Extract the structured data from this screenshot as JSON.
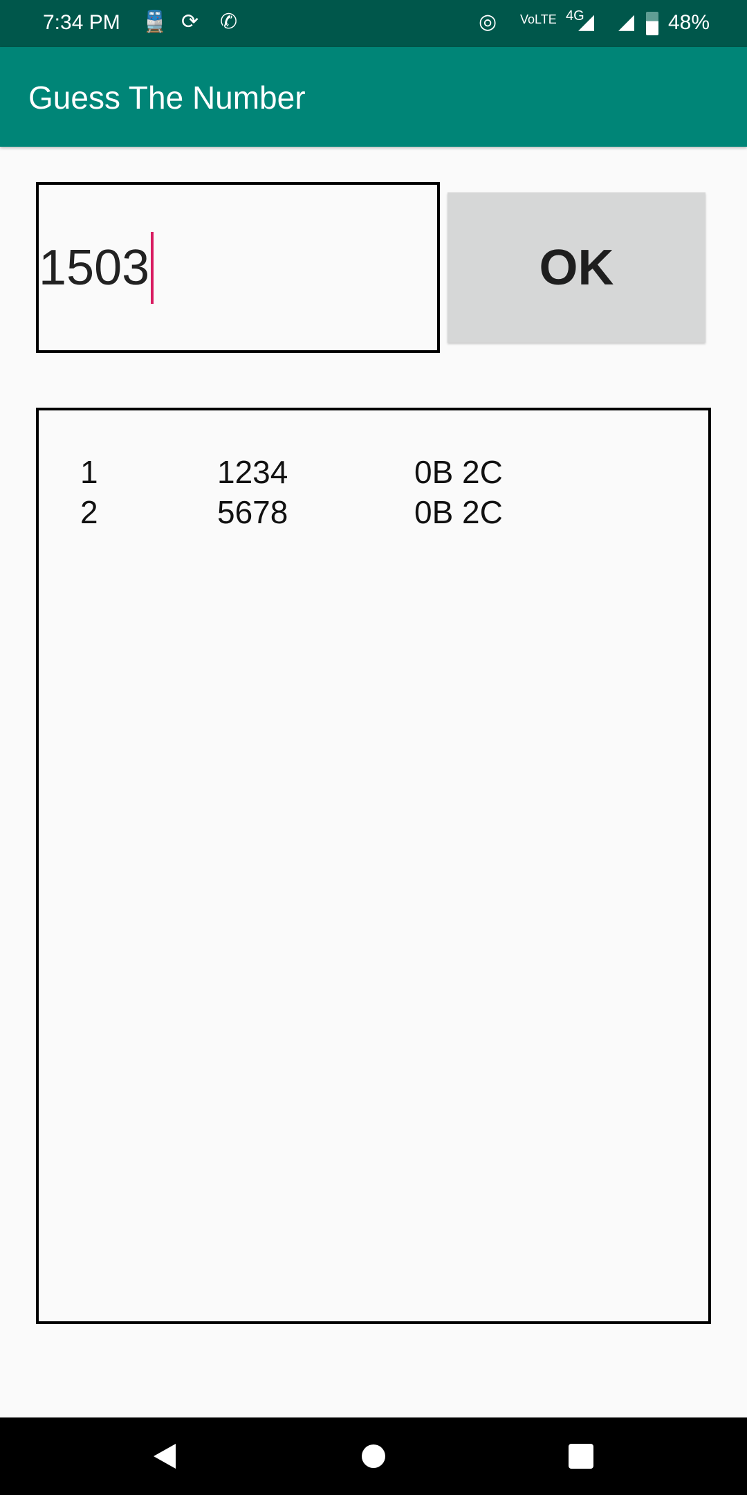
{
  "status_bar": {
    "time": "7:34 PM",
    "battery": "48%",
    "network": "4G"
  },
  "app_bar": {
    "title": "Guess The Number"
  },
  "input": {
    "value": "1503"
  },
  "ok_button": {
    "label": "OK"
  },
  "guesses": [
    {
      "index": "1",
      "guess": "1234",
      "result": "0B 2C"
    },
    {
      "index": "2",
      "guess": "5678",
      "result": "0B 2C"
    }
  ],
  "colors": {
    "status_bar": "#00574b",
    "app_bar": "#008577",
    "cursor": "#d81b60",
    "button": "#d6d7d7"
  }
}
